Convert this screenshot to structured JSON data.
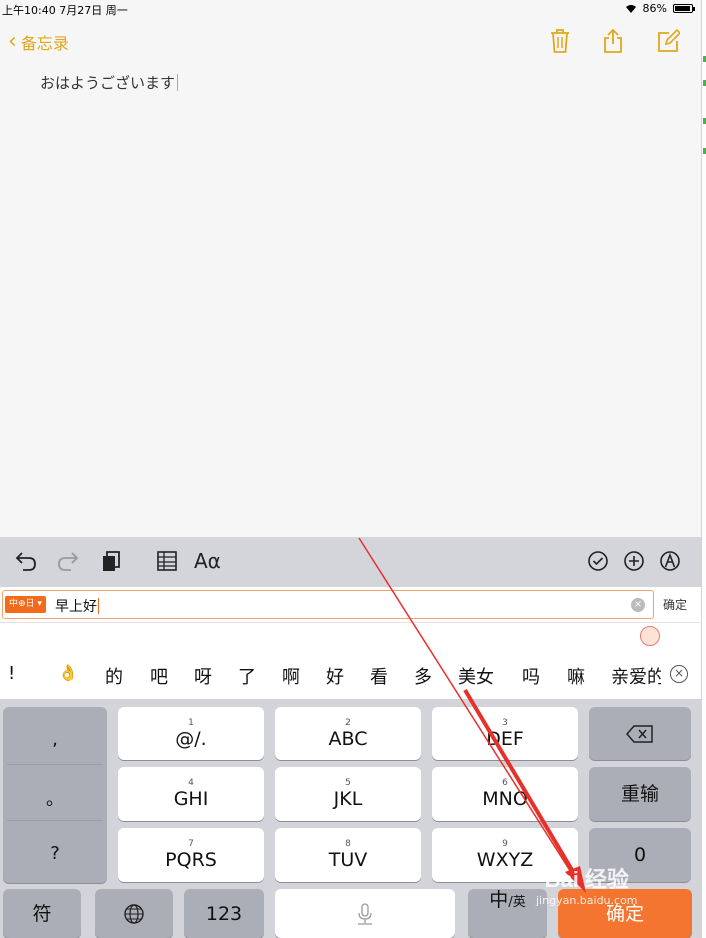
{
  "status_bar": {
    "time": "上午10:40   7月27日 周一",
    "battery": "86%"
  },
  "nav": {
    "back_label": "备忘录",
    "icons": [
      "trash-icon",
      "share-icon",
      "compose-icon"
    ]
  },
  "note": {
    "text": "おはようございます"
  },
  "format_toolbar": {
    "left": [
      "undo-icon",
      "redo-icon",
      "copy-icon",
      "table-icon"
    ],
    "font_label": "Aα",
    "right": [
      "checklist-icon",
      "add-icon",
      "markup-icon"
    ]
  },
  "ime": {
    "mode_label": "中⊕日",
    "composition": "早上好",
    "confirm_label": "确定"
  },
  "candidates": [
    "!",
    "的",
    "吧",
    "呀",
    "了",
    "啊",
    "好",
    "看",
    "多",
    "美女",
    "吗",
    "嘛",
    "亲爱的"
  ],
  "keyboard": {
    "punct": [
      ",",
      "。",
      "?"
    ],
    "keys": [
      {
        "num": "1",
        "label": "@/."
      },
      {
        "num": "2",
        "label": "ABC"
      },
      {
        "num": "3",
        "label": "DEF"
      },
      {
        "num": "4",
        "label": "GHI"
      },
      {
        "num": "5",
        "label": "JKL"
      },
      {
        "num": "6",
        "label": "MNO"
      },
      {
        "num": "7",
        "label": "PQRS"
      },
      {
        "num": "8",
        "label": "TUV"
      },
      {
        "num": "9",
        "label": "WXYZ"
      }
    ],
    "reenter_label": "重输",
    "zero_label": "0",
    "symbol_label": "符",
    "num_label": "123",
    "lang_main": "中",
    "lang_sub": "/英",
    "confirm_label": "确定"
  },
  "annotation": {
    "arrow_color": "#e8302a"
  },
  "watermark": {
    "logo": "Bai 经验",
    "url": "jingyan.baidu.com"
  }
}
